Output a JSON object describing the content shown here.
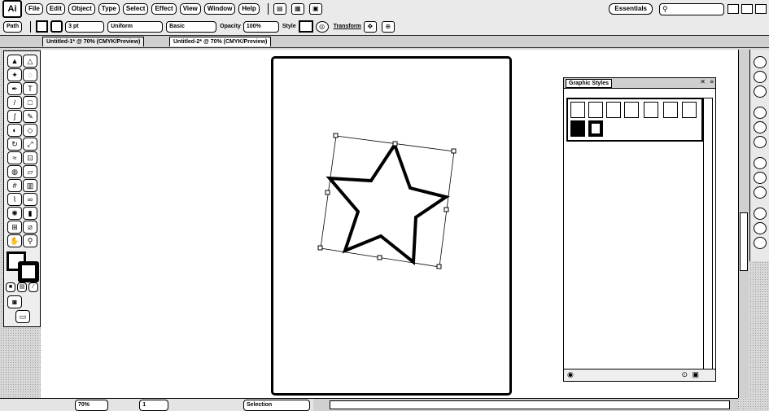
{
  "app": {
    "logo": "Ai"
  },
  "menu": {
    "items": [
      "File",
      "Edit",
      "Object",
      "Type",
      "Select",
      "Effect",
      "View",
      "Window",
      "Help"
    ],
    "workspace": "Essentials",
    "search_placeholder": ""
  },
  "control": {
    "mode": "Path",
    "stroke_weight": "3 pt",
    "stroke_profile": "Uniform",
    "brush": "Basic",
    "opacity_label": "Opacity",
    "opacity_value": "100%",
    "style_label": "Style",
    "transform_label": "Transform"
  },
  "tabs": [
    {
      "label": "Untitled-1* @ 70% (CMYK/Preview)"
    },
    {
      "label": "Untitled-2* @ 70% (CMYK/Preview)"
    }
  ],
  "status": {
    "zoom": "70%",
    "artboard": "1",
    "tool_name": "Selection"
  },
  "panel": {
    "title": "Graphic Styles"
  },
  "icons": {
    "search": "search-icon",
    "star": "star-shape",
    "selection": "selection-tool-icon"
  }
}
